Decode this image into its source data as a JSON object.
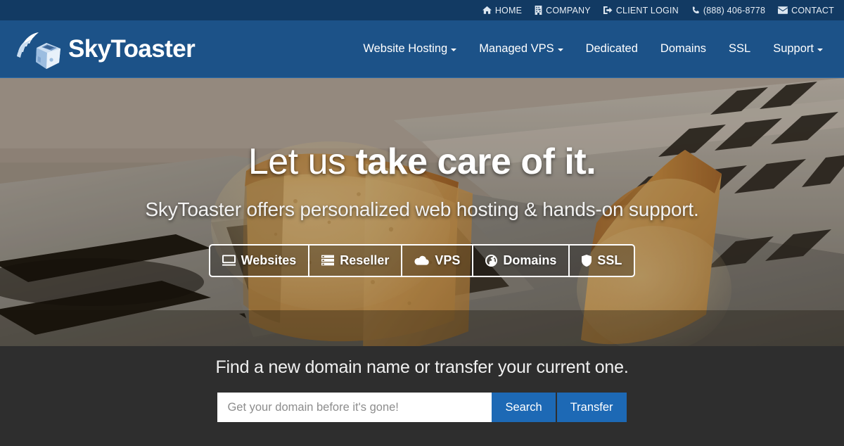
{
  "colors": {
    "topbar_bg": "#123a63",
    "header_bg": "#1c5288",
    "accent_blue": "#1d69b5",
    "dark_band": "#2e2e2e",
    "white": "#ffffff"
  },
  "topbar": {
    "links": [
      {
        "label": "HOME",
        "icon": "home-icon"
      },
      {
        "label": "COMPANY",
        "icon": "building-icon"
      },
      {
        "label": "CLIENT LOGIN",
        "icon": "sign-in-icon"
      },
      {
        "label": "(888) 406-8778",
        "icon": "phone-icon"
      },
      {
        "label": "CONTACT",
        "icon": "envelope-icon"
      }
    ]
  },
  "header": {
    "brand_name": "SkyToaster",
    "logo_icon": "winged-toaster-logo",
    "nav": [
      {
        "label": "Website Hosting",
        "has_dropdown": true
      },
      {
        "label": "Managed VPS",
        "has_dropdown": true
      },
      {
        "label": "Dedicated",
        "has_dropdown": false
      },
      {
        "label": "Domains",
        "has_dropdown": false
      },
      {
        "label": "SSL",
        "has_dropdown": false
      },
      {
        "label": "Support",
        "has_dropdown": true
      }
    ]
  },
  "hero": {
    "title_light": "Let us ",
    "title_bold": "take care of it.",
    "subtitle": "SkyToaster offers personalized web hosting & hands-on support.",
    "buttons": [
      {
        "label": "Websites",
        "icon": "desktop-monitor-icon"
      },
      {
        "label": "Reseller",
        "icon": "server-stack-icon"
      },
      {
        "label": "VPS",
        "icon": "cloud-icon"
      },
      {
        "label": "Domains",
        "icon": "globe-icon"
      },
      {
        "label": "SSL",
        "icon": "shield-icon"
      }
    ]
  },
  "domain_search": {
    "heading": "Find a new domain name or transfer your current one.",
    "input_value": "",
    "input_placeholder": "Get your domain before it's gone!",
    "search_label": "Search",
    "transfer_label": "Transfer"
  }
}
